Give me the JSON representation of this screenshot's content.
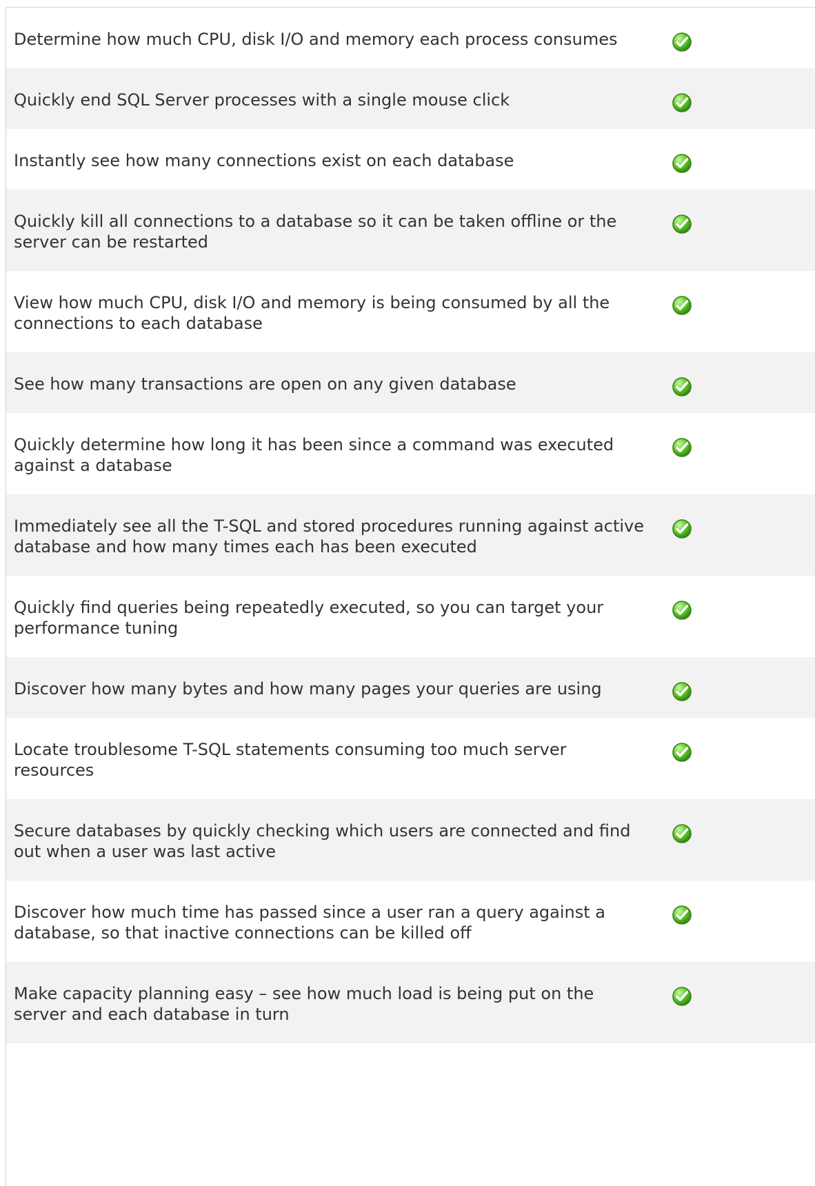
{
  "features": {
    "rows": [
      {
        "text": "Determine how much CPU, disk I/O and memory each process consumes",
        "icon": "green-check-icon"
      },
      {
        "text": "Quickly end SQL Server processes with a single mouse click",
        "icon": "green-check-icon"
      },
      {
        "text": "Instantly see how many connections exist on each database",
        "icon": "green-check-icon"
      },
      {
        "text": "Quickly kill all connections to a database so it can be taken offline or the server can be restarted",
        "icon": "green-check-icon"
      },
      {
        "text": "View how much CPU, disk I/O and memory is being consumed by all the connections to each database",
        "icon": "green-check-icon"
      },
      {
        "text": "See how many transactions are open on any given database",
        "icon": "green-check-icon"
      },
      {
        "text": "Quickly determine how long it has been since a command was executed against a database",
        "icon": "green-check-icon"
      },
      {
        "text": "Immediately see all the T-SQL and stored procedures running against active database and how many times each has been executed",
        "icon": "green-check-icon"
      },
      {
        "text": "Quickly find queries being repeatedly executed, so you can target your performance tuning",
        "icon": "green-check-icon"
      },
      {
        "text": "Discover how many bytes and how many pages your queries are using",
        "icon": "green-check-icon"
      },
      {
        "text": "Locate troublesome T-SQL statements consuming too much server resources",
        "icon": "green-check-icon"
      },
      {
        "text": "Secure databases by quickly checking which users are connected and find out when a user was last active",
        "icon": "green-check-icon"
      },
      {
        "text": "Discover how much time has passed since a user ran a query against a database, so that inactive connections can be killed off",
        "icon": "green-check-icon"
      },
      {
        "text": "Make capacity planning easy – see how much load is being put on the server and each database in turn",
        "icon": "green-check-icon"
      }
    ]
  },
  "colors": {
    "text": "#333333",
    "row_shade": "#f2f2f2",
    "border": "#cfcfcf",
    "check_green": "#55c21b"
  }
}
